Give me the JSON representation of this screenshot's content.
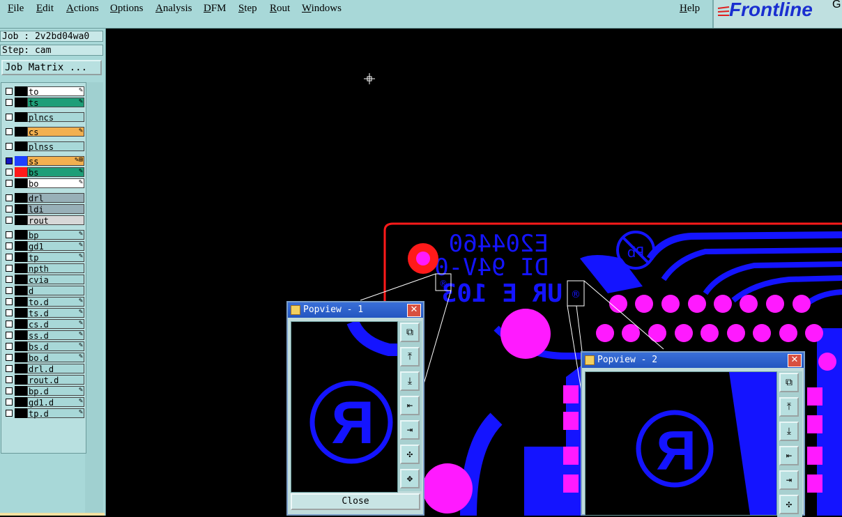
{
  "menubar": {
    "items": [
      "File",
      "Edit",
      "Actions",
      "Options",
      "Analysis",
      "DFM",
      "Step",
      "Rout",
      "Windows"
    ],
    "help": "Help",
    "logo": "Frontline",
    "logo_suffix": "G"
  },
  "job": {
    "job_label": "Job : 2v2bd04wa0",
    "step_label": "Step: cam",
    "matrix_button": "Job Matrix ..."
  },
  "layers": [
    {
      "name": "to",
      "color": "#ffffff",
      "mark": "✎"
    },
    {
      "name": "ts",
      "color": "#1e9e78",
      "mark": "✎"
    },
    {
      "name": "plncs",
      "color": "#a8d8d8",
      "mark": ""
    },
    {
      "name": "cs",
      "color": "#f2b050",
      "mark": "✎"
    },
    {
      "name": "plnss",
      "color": "#a8d8d8",
      "mark": ""
    },
    {
      "name": "ss",
      "color": "#f2b050",
      "mark": "✎⊞",
      "active": true
    },
    {
      "name": "bs",
      "color": "#1e9e78",
      "mark": "✎"
    },
    {
      "name": "bo",
      "color": "#ffffff",
      "mark": "✎"
    },
    {
      "name": "drl",
      "color": "#98b0b8",
      "mark": ""
    },
    {
      "name": "ldi",
      "color": "#98b0b8",
      "mark": ""
    },
    {
      "name": "rout",
      "color": "#d8d8d8",
      "mark": ""
    },
    {
      "name": "bp",
      "color": "#a8d8d8",
      "mark": "✎"
    },
    {
      "name": "gd1",
      "color": "#a8d8d8",
      "mark": "✎"
    },
    {
      "name": "tp",
      "color": "#a8d8d8",
      "mark": "✎"
    },
    {
      "name": "npth",
      "color": "#a8d8d8",
      "mark": ""
    },
    {
      "name": "cvia",
      "color": "#a8d8d8",
      "mark": ""
    },
    {
      "name": "d",
      "color": "#a8d8d8",
      "mark": ""
    },
    {
      "name": "to.d",
      "color": "#a8d8d8",
      "mark": "✎"
    },
    {
      "name": "ts.d",
      "color": "#a8d8d8",
      "mark": "✎"
    },
    {
      "name": "cs.d",
      "color": "#a8d8d8",
      "mark": "✎"
    },
    {
      "name": "ss.d",
      "color": "#a8d8d8",
      "mark": "✎"
    },
    {
      "name": "bs.d",
      "color": "#a8d8d8",
      "mark": "✎"
    },
    {
      "name": "bo.d",
      "color": "#a8d8d8",
      "mark": "✎"
    },
    {
      "name": "drl.d",
      "color": "#a8d8d8",
      "mark": ""
    },
    {
      "name": "rout.d",
      "color": "#a8d8d8",
      "mark": ""
    },
    {
      "name": "bp.d",
      "color": "#a8d8d8",
      "mark": "✎"
    },
    {
      "name": "gd1.d",
      "color": "#a8d8d8",
      "mark": "✎"
    },
    {
      "name": "tp.d",
      "color": "#a8d8d8",
      "mark": "✎"
    }
  ],
  "board": {
    "silk_line1": "E204460",
    "silk_line2": "DI 94V-0",
    "silk_line3": "UR E 103",
    "pb_mark": "Pb",
    "colors": {
      "copper": "#1414ff",
      "pad": "#ff1aff",
      "outline": "#ff1a1a"
    }
  },
  "popview1": {
    "title": "Popview - 1",
    "close_label": "Close"
  },
  "popview2": {
    "title": "Popview - 2"
  }
}
